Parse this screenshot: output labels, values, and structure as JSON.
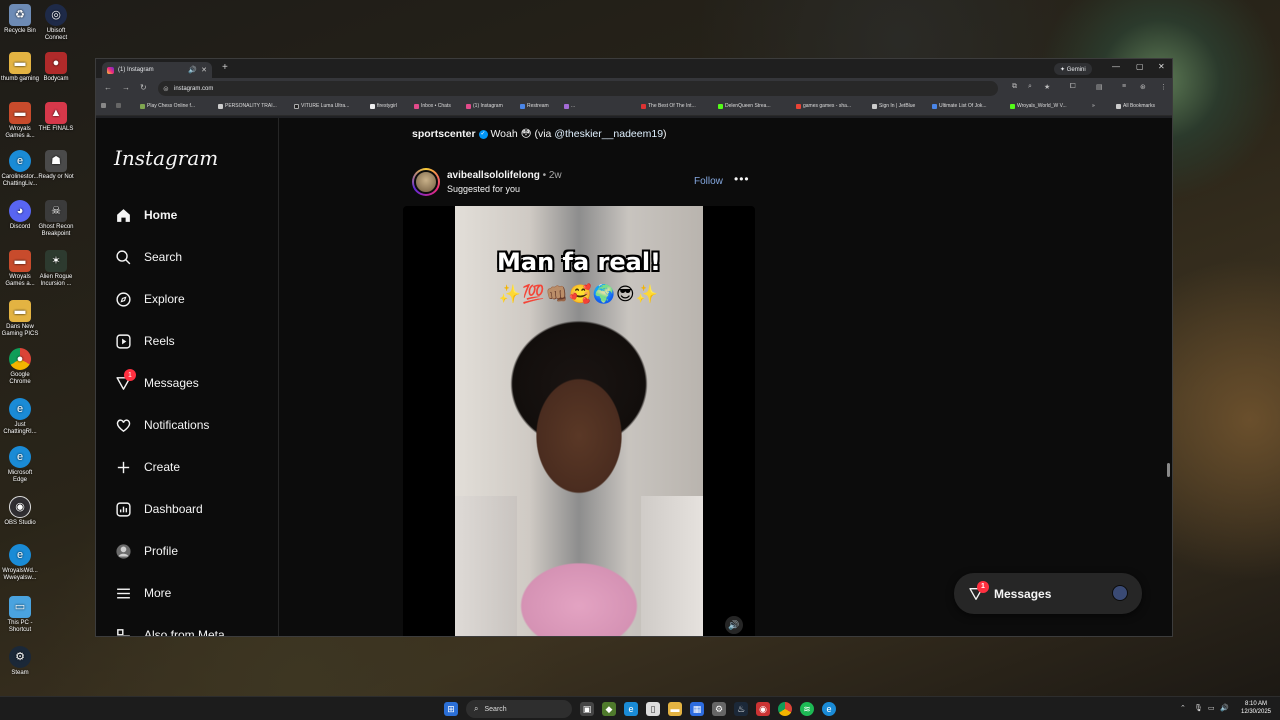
{
  "desktop": {
    "icons": [
      {
        "label": "Recycle Bin",
        "icon": "recycle-bin-icon",
        "color": "#6d8bb5"
      },
      {
        "label": "Ubisoft Connect",
        "icon": "ubisoft-icon",
        "color": "#1e2a48"
      },
      {
        "label": "thumb gaming",
        "icon": "folder-icon",
        "color": "#e3b342"
      },
      {
        "label": "Bodycam",
        "icon": "bodycam-icon",
        "color": "#b02a2a"
      },
      {
        "label": "Wroyals Games a...",
        "icon": "folder-icon",
        "color": "#c84b2c"
      },
      {
        "label": "THE FINALS",
        "icon": "the-finals-icon",
        "color": "#d6384a"
      },
      {
        "label": "Carolinestor... ChattingLiv...",
        "icon": "edge-icon",
        "color": "#1a8bd6"
      },
      {
        "label": "Ready or Not",
        "icon": "ready-or-not-icon",
        "color": "#4a4a4a"
      },
      {
        "label": "Discord",
        "icon": "discord-icon",
        "color": "#5865f2"
      },
      {
        "label": "Ghost Recon Breakpoint",
        "icon": "ghost-recon-icon",
        "color": "#3b3b3b"
      },
      {
        "label": "Wroyals Games a...",
        "icon": "folder-icon",
        "color": "#c84b2c"
      },
      {
        "label": "Alien Rogue Incursion ...",
        "icon": "alien-rogue-icon",
        "color": "#2d3a2f"
      },
      {
        "label": "Dans New Gaming PICS",
        "icon": "folder-icon",
        "color": "#e3b342"
      },
      {
        "label": "Google Chrome",
        "icon": "chrome-icon",
        "color": "#2e9b4a"
      },
      {
        "label": "Just ChattingRI...",
        "icon": "edge-icon",
        "color": "#1a8bd6"
      },
      {
        "label": "Microsoft Edge",
        "icon": "edge-icon",
        "color": "#1a8bd6"
      },
      {
        "label": "OBS Studio",
        "icon": "obs-icon",
        "color": "#302e31"
      },
      {
        "label": "WroyalsWd... Wweyalsw...",
        "icon": "edge-icon",
        "color": "#1a8bd6"
      },
      {
        "label": "This PC - Shortcut",
        "icon": "this-pc-icon",
        "color": "#4aa3df"
      },
      {
        "label": "Steam",
        "icon": "steam-icon",
        "color": "#1b2838"
      }
    ]
  },
  "browser": {
    "tab_title": "(1) Instagram",
    "new_tab": "+",
    "gemini_label": "✦ Gemini",
    "url": "instagram.com",
    "bookmarks": [
      "Play Chess Online f...",
      "PERSONALITY TRAI...",
      "VITURE Luma Ultra...",
      "firestygirl",
      "Inbox • Chats",
      "(1) Instagram",
      "Restream",
      "...",
      "The Best Of The Int...",
      "DelenQueen Strea...",
      "games games - sha...",
      "Sign In | JetBlue",
      "Ultimate List Of Jok...",
      "Wroyals_World_W V...",
      "»",
      "All Bookmarks"
    ]
  },
  "instagram": {
    "logo": "Instagram",
    "nav": [
      {
        "label": "Home",
        "icon": "home-icon"
      },
      {
        "label": "Search",
        "icon": "search-icon"
      },
      {
        "label": "Explore",
        "icon": "compass-icon"
      },
      {
        "label": "Reels",
        "icon": "reels-icon"
      },
      {
        "label": "Messages",
        "icon": "messenger-icon",
        "badge": "1"
      },
      {
        "label": "Notifications",
        "icon": "heart-icon"
      },
      {
        "label": "Create",
        "icon": "plus-icon"
      },
      {
        "label": "Dashboard",
        "icon": "dashboard-icon"
      },
      {
        "label": "Profile",
        "icon": "avatar-icon"
      },
      {
        "label": "More",
        "icon": "hamburger-icon"
      },
      {
        "label": "Also from Meta",
        "icon": "meta-icon"
      }
    ],
    "caption": {
      "user": "sportscenter",
      "text": "Woah 😳 (via ",
      "mention": "@theskier__nadeem19",
      "close": ")"
    },
    "post": {
      "username": "avibeallsololifelong",
      "time": " • 2w",
      "subtitle": "Suggested for you",
      "follow": "Follow",
      "more": "•••",
      "video_title": "Man fa real!",
      "video_emojis": "✨💯👊🏽🥰🌍😎✨"
    },
    "messages_pill": {
      "label": "Messages",
      "badge": "1"
    }
  },
  "taskbar": {
    "search_placeholder": "Search",
    "time": "8:10 AM",
    "date": "12/30/2025"
  },
  "colors": {
    "accent": "#0095f6",
    "badge": "#ff3040",
    "follow": "#85a8e0"
  }
}
